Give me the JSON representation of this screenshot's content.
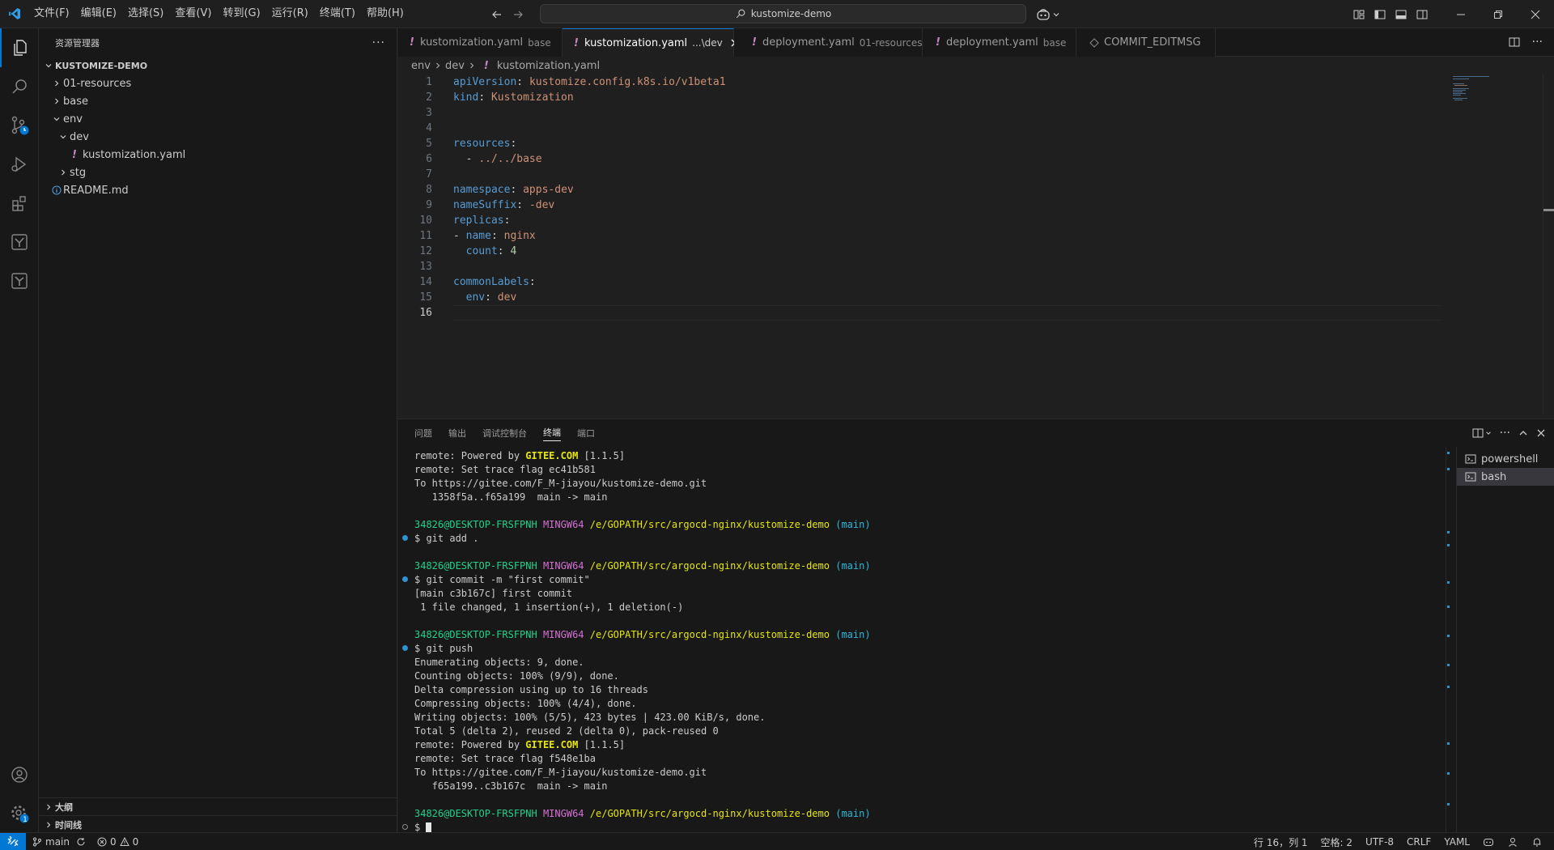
{
  "menu": [
    "文件(F)",
    "编辑(E)",
    "选择(S)",
    "查看(V)",
    "转到(G)",
    "运行(R)",
    "终端(T)",
    "帮助(H)"
  ],
  "command_center": {
    "text": "kustomize-demo"
  },
  "explorer": {
    "title": "资源管理器",
    "root": "KUSTOMIZE-DEMO",
    "items": [
      {
        "label": "01-resources"
      },
      {
        "label": "base"
      },
      {
        "label": "env"
      },
      {
        "label": "dev"
      },
      {
        "label": "kustomization.yaml"
      },
      {
        "label": "stg"
      },
      {
        "label": "README.md"
      }
    ],
    "outline": "大纲",
    "timeline": "时间线"
  },
  "tabs": [
    {
      "name": "kustomization.yaml",
      "desc": "base"
    },
    {
      "name": "kustomization.yaml",
      "desc": "...\\dev"
    },
    {
      "name": "deployment.yaml",
      "desc": "01-resources"
    },
    {
      "name": "deployment.yaml",
      "desc": "base"
    },
    {
      "name": "COMMIT_EDITMSG",
      "desc": ""
    }
  ],
  "breadcrumb": [
    "env",
    "dev",
    "kustomization.yaml"
  ],
  "editor": {
    "line_numbers": [
      "1",
      "2",
      "3",
      "4",
      "5",
      "6",
      "7",
      "8",
      "9",
      "10",
      "11",
      "12",
      "13",
      "14",
      "15",
      "16"
    ],
    "lines": [
      {
        "k": "apiVersion",
        "s": ": ",
        "v": "kustomize.config.k8s.io/v1beta1"
      },
      {
        "k": "kind",
        "s": ": ",
        "v": "Kustomization"
      },
      {
        "k": "",
        "s": "",
        "v": ""
      },
      {
        "k": "",
        "s": "",
        "v": ""
      },
      {
        "k": "resources",
        "s": ":",
        "v": ""
      },
      {
        "k": "",
        "s": "  - ",
        "v": "../../base"
      },
      {
        "k": "",
        "s": "",
        "v": ""
      },
      {
        "k": "namespace",
        "s": ": ",
        "v": "apps-dev"
      },
      {
        "k": "nameSuffix",
        "s": ": ",
        "v": "-dev"
      },
      {
        "k": "replicas",
        "s": ":",
        "v": ""
      },
      {
        "k": "name",
        "pre": "- ",
        "s": ": ",
        "v": "nginx"
      },
      {
        "k": "count",
        "pre": "  ",
        "s": ": ",
        "n": "4"
      },
      {
        "k": "",
        "s": "",
        "v": ""
      },
      {
        "k": "commonLabels",
        "s": ":",
        "v": ""
      },
      {
        "k": "env",
        "pre": "  ",
        "s": ": ",
        "v": "dev"
      },
      {
        "k": "",
        "s": "",
        "v": ""
      }
    ]
  },
  "panel": {
    "tabs": [
      "问题",
      "输出",
      "调试控制台",
      "终端",
      "端口"
    ],
    "terminals": [
      "powershell",
      "bash"
    ]
  },
  "terminal": {
    "prompt_user": "34826@DESKTOP-FRSFPNH",
    "prompt_env": "MINGW64",
    "prompt_path": "/e/GOPATH/src/argocd-nginx/kustomize-demo",
    "prompt_branch": "(main)",
    "lines": [
      "remote: Powered by ",
      "GITEE.COM",
      " [1.1.5]",
      "remote: Set trace flag ec41b581",
      "To https://gitee.com/F_M-jiayou/kustomize-demo.git",
      "   1358f5a..f65a199  main -> main",
      "$ git add .",
      "$ git commit -m \"first commit\"",
      "[main c3b167c] first commit",
      " 1 file changed, 1 insertion(+), 1 deletion(-)",
      "$ git push",
      "Enumerating objects: 9, done.",
      "Counting objects: 100% (9/9), done.",
      "Delta compression using up to 16 threads",
      "Compressing objects: 100% (4/4), done.",
      "Writing objects: 100% (5/5), 423 bytes | 423.00 KiB/s, done.",
      "Total 5 (delta 2), reused 2 (delta 0), pack-reused 0",
      "remote: Set trace flag f548e1ba",
      "To https://gitee.com/F_M-jiayou/kustomize-demo.git",
      "   f65a199..c3b167c  main -> main",
      "$ "
    ]
  },
  "status": {
    "branch": "main",
    "errors": "0",
    "warnings": "0",
    "position": "行 16，列 1",
    "spaces": "空格: 2",
    "encoding": "UTF-8",
    "eol": "CRLF",
    "language": "YAML",
    "badge": "1"
  },
  "colors": {
    "accent": "#0078d4",
    "yaml_key": "#569cd6",
    "yaml_value": "#ce9178"
  }
}
